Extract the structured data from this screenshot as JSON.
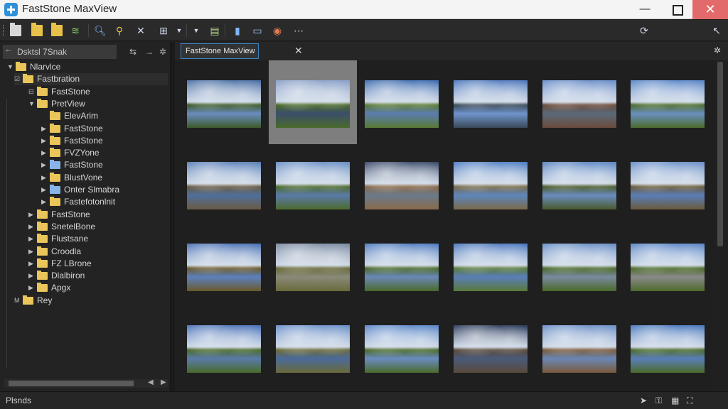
{
  "window": {
    "title": "FastStone MaxView",
    "minimize": "—",
    "close": "✕"
  },
  "toolbar": {
    "icons": [
      "open-file-icon",
      "open-folder-icon",
      "folder-icon",
      "edit-icon",
      "zoom-icon",
      "search-icon",
      "close-icon",
      "grid-icon",
      "dropdown-icon",
      "sort-icon",
      "copy-icon",
      "bookmark-icon",
      "print-icon",
      "web-icon",
      "more-icon",
      "refresh-icon",
      "arrow-icon"
    ]
  },
  "left": {
    "path": "Dsktsl 7Snak",
    "tree": [
      {
        "label": "Nlarvlce",
        "level": 0,
        "toggle": "▼",
        "blue": false
      },
      {
        "label": "Fastbration",
        "level": 1,
        "toggle": "☑",
        "blue": false
      },
      {
        "label": "FastStone",
        "level": 2,
        "toggle": "⊟",
        "blue": false
      },
      {
        "label": "PretView",
        "level": 2,
        "toggle": "▼",
        "blue": false
      },
      {
        "label": "ElevArim",
        "level": 3,
        "toggle": "",
        "blue": false
      },
      {
        "label": "FastStone",
        "level": 3,
        "toggle": "▶",
        "blue": false
      },
      {
        "label": "FastStone",
        "level": 3,
        "toggle": "▶",
        "blue": false
      },
      {
        "label": "FVZYone",
        "level": 3,
        "toggle": "▶",
        "blue": false
      },
      {
        "label": "FastStone",
        "level": 3,
        "toggle": "▶",
        "blue": true
      },
      {
        "label": "BlustVone",
        "level": 3,
        "toggle": "▶",
        "blue": false
      },
      {
        "label": "Onter Slmabra",
        "level": 3,
        "toggle": "▶",
        "blue": true
      },
      {
        "label": "Fastefotonlnit",
        "level": 3,
        "toggle": "▶",
        "blue": false
      },
      {
        "label": "FastStone",
        "level": 2,
        "toggle": "▶",
        "blue": false
      },
      {
        "label": "SnetelBone",
        "level": 2,
        "toggle": "▶",
        "blue": false
      },
      {
        "label": "Flustsane",
        "level": 2,
        "toggle": "▶",
        "blue": false
      },
      {
        "label": "Croodla",
        "level": 2,
        "toggle": "▶",
        "blue": false
      },
      {
        "label": "FZ LBrone",
        "level": 2,
        "toggle": "▶",
        "blue": false
      },
      {
        "label": "Dlalbiron",
        "level": 2,
        "toggle": "▶",
        "blue": false
      },
      {
        "label": "Apgx",
        "level": 2,
        "toggle": "▶",
        "blue": false
      },
      {
        "label": "Rey",
        "level": 1,
        "toggle": "M",
        "blue": false
      }
    ]
  },
  "tab": {
    "label": "FastStone MaxView",
    "close": "✕"
  },
  "thumbnails": [
    {
      "sky": "#4a6fa5",
      "ground": "#3d5a2a",
      "water": "#6a8cbf"
    },
    {
      "sky": "#8aa0c8",
      "ground": "#4a6a2a",
      "water": "#3a4e6a"
    },
    {
      "sky": "#3f6db0",
      "ground": "#5a7a34",
      "water": "#5b7db0"
    },
    {
      "sky": "#4d78bd",
      "ground": "#3b4a5a",
      "water": "#6f93cc"
    },
    {
      "sky": "#6a8ec9",
      "ground": "#6b4a3a",
      "water": "#5a6a7a"
    },
    {
      "sky": "#5a86c8",
      "ground": "#4b6b2b",
      "water": "#6b8fc0"
    },
    {
      "sky": "#5a80b8",
      "ground": "#6a5a44",
      "water": "#4f6f9a"
    },
    {
      "sky": "#6a8fc4",
      "ground": "#4d6b2d",
      "water": "#5a7aa8"
    },
    {
      "sky": "#3a4a6a",
      "ground": "#8a6a4a",
      "water": "#6a7a8a"
    },
    {
      "sky": "#4f7ec2",
      "ground": "#7a6a4a",
      "water": "#5d86bd"
    },
    {
      "sky": "#5b85c2",
      "ground": "#4a5a2a",
      "water": "#6a8cc0"
    },
    {
      "sky": "#6b90c8",
      "ground": "#6a5a3a",
      "water": "#5a7eb8"
    },
    {
      "sky": "#4a72b4",
      "ground": "#6a5a2a",
      "water": "#5b80bd"
    },
    {
      "sky": "#7a8aa0",
      "ground": "#6a6a3a",
      "water": "#8a8a7a"
    },
    {
      "sky": "#4f7cc0",
      "ground": "#4a6a2a",
      "water": "#6a88b8"
    },
    {
      "sky": "#4c78bd",
      "ground": "#5a7a3a",
      "water": "#5a7eb8"
    },
    {
      "sky": "#6a8fc6",
      "ground": "#4a6a2a",
      "water": "#7a8aa0"
    },
    {
      "sky": "#5b86c6",
      "ground": "#4d6b2b",
      "water": "#8a8a8a"
    },
    {
      "sky": "#4a72b8",
      "ground": "#4a6a2a",
      "water": "#5a7aaa"
    },
    {
      "sky": "#6a8fc8",
      "ground": "#6a6a3a",
      "water": "#4a6a9a"
    },
    {
      "sky": "#5a86c8",
      "ground": "#4a6a2a",
      "water": "#6a8cc0"
    },
    {
      "sky": "#2a3a5a",
      "ground": "#5a4a3a",
      "water": "#4a5a7a"
    },
    {
      "sky": "#6b8fc6",
      "ground": "#7a5a3a",
      "water": "#6a86b6"
    },
    {
      "sky": "#4a78bd",
      "ground": "#4b6b2b",
      "water": "#5a7eb8"
    }
  ],
  "status": {
    "text": "Plsnds",
    "icons": [
      "cursor-icon",
      "lock-icon",
      "grid-icon",
      "fit-icon"
    ]
  },
  "selected_thumbnail": 1
}
